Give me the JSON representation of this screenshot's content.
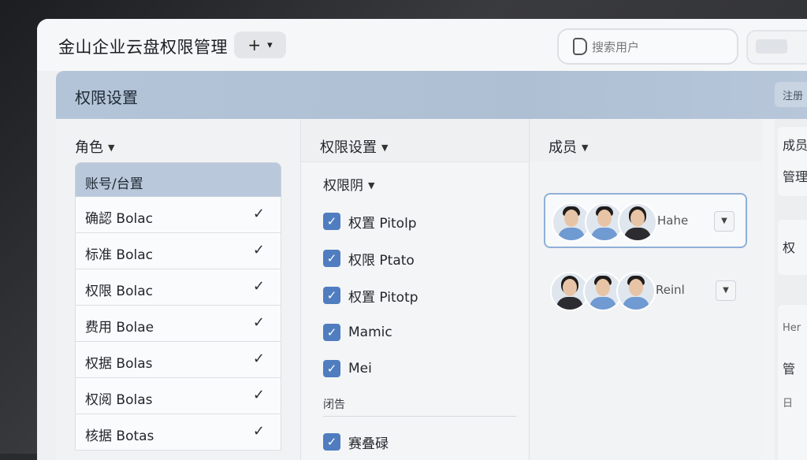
{
  "app": {
    "title": "金山企业云盘权限管理",
    "add_label": "+",
    "add_caret": "▾"
  },
  "search": {
    "placeholder": "搜索用户",
    "icon": "search-icon"
  },
  "panel": {
    "title": "权限设置",
    "header_button": "注册"
  },
  "roles": {
    "heading": "角色",
    "list_header": "账号/台置",
    "items": [
      {
        "label": "确認 Bolac"
      },
      {
        "label": "标准 Bolac"
      },
      {
        "label": "权限 Bolac"
      },
      {
        "label": "费用 Bolae"
      },
      {
        "label": "权据 Bolas"
      },
      {
        "label": "权阅 Bolas"
      },
      {
        "label": "核据 Botas"
      }
    ]
  },
  "permissions": {
    "heading": "权限设置",
    "sub_heading": "权限阴",
    "items": [
      {
        "label": "权置 Pitolp"
      },
      {
        "label": "权限 Ptato"
      },
      {
        "label": "权置 Pitotp"
      },
      {
        "label": "Mamic"
      },
      {
        "label": "Mei"
      }
    ],
    "group_label": "闭告",
    "extra_item": {
      "label": "赛叠碌"
    }
  },
  "members": {
    "heading": "成员",
    "items": [
      {
        "name": "Hahe",
        "selected": true
      },
      {
        "name": "Reinl",
        "selected": false
      }
    ]
  },
  "right_column": {
    "items": [
      "成员",
      "管理",
      "权",
      "Her",
      "管",
      "日"
    ]
  },
  "colors": {
    "accent": "#4f7dc0",
    "header_bg": "#b4c4d8",
    "selected_border": "#8fb0d8"
  }
}
